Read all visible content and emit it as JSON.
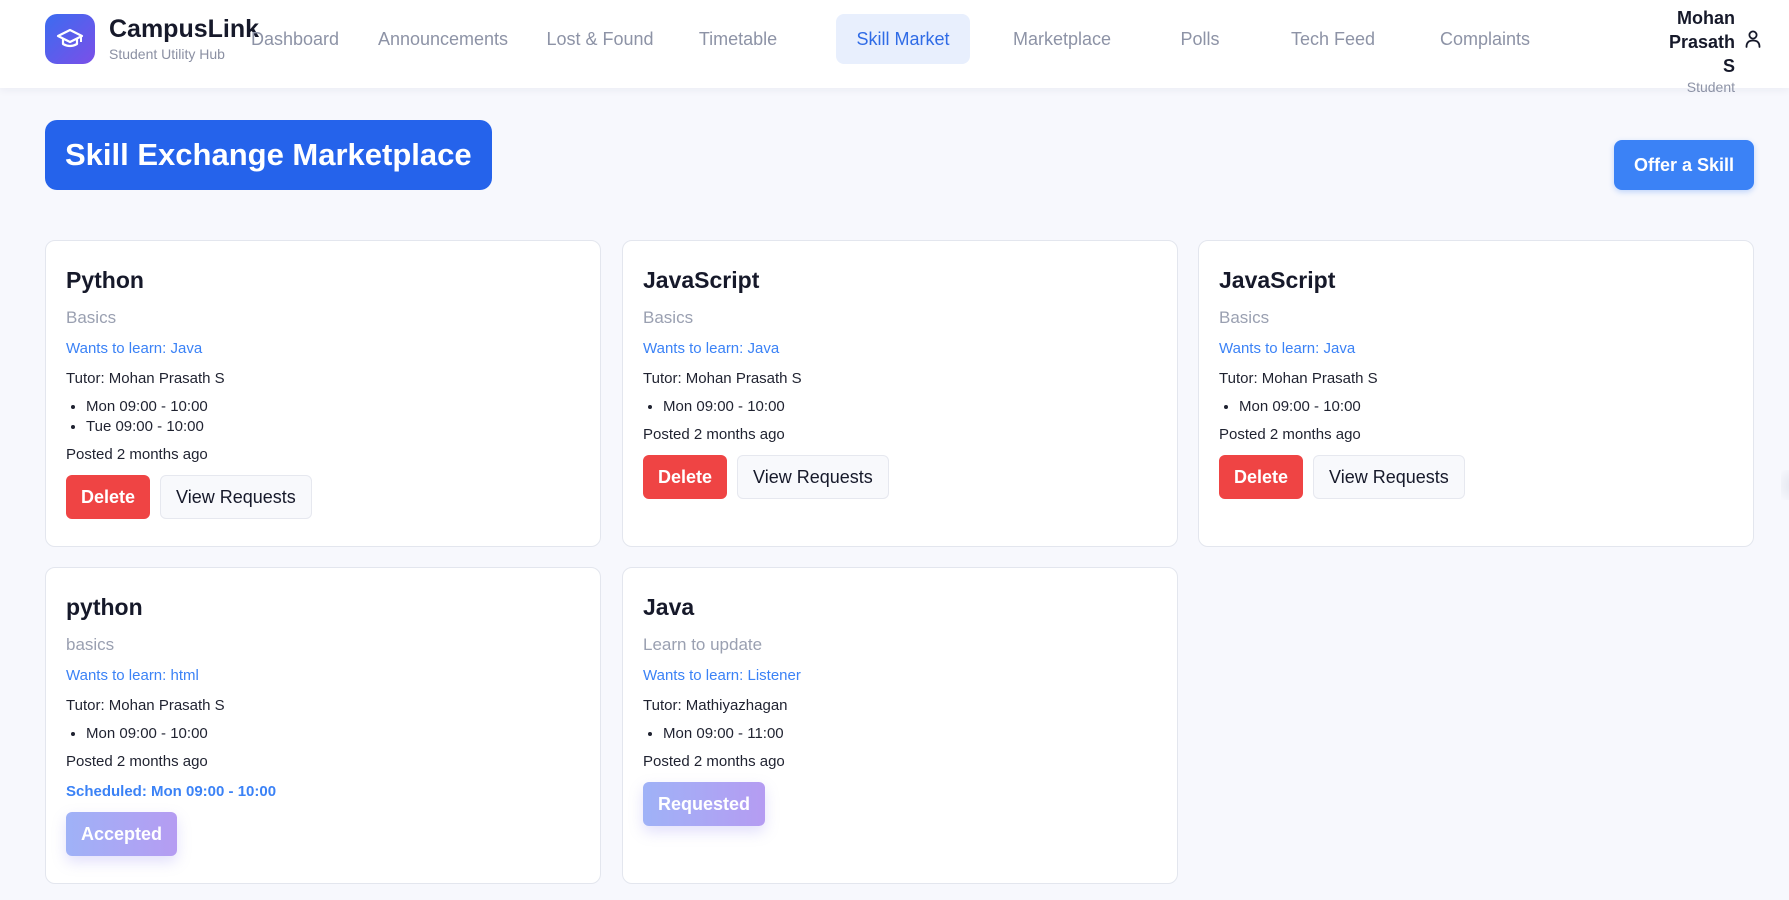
{
  "brand": {
    "name": "CampusLink",
    "subtitle": "Student Utility Hub",
    "logo_icon": "graduation-cap-icon"
  },
  "nav": {
    "items": [
      {
        "label": "Dashboard",
        "active": false
      },
      {
        "label": "Announcements",
        "active": false
      },
      {
        "label": "Lost & Found",
        "active": false
      },
      {
        "label": "Timetable",
        "active": false
      },
      {
        "label": "Skill Market",
        "active": true
      },
      {
        "label": "Marketplace",
        "active": false
      },
      {
        "label": "Polls",
        "active": false
      },
      {
        "label": "Tech Feed",
        "active": false
      },
      {
        "label": "Complaints",
        "active": false
      }
    ]
  },
  "user": {
    "name": "Mohan Prasath S",
    "role": "Student",
    "icon": "user-icon"
  },
  "page": {
    "title": "Skill Exchange Marketplace",
    "offer_button": "Offer a Skill"
  },
  "cards": [
    {
      "title": "Python",
      "description": "Basics",
      "wants": "Wants to learn: Java",
      "tutor": "Tutor: Mohan Prasath S",
      "slots": [
        "Mon 09:00 - 10:00",
        "Tue 09:00 - 10:00"
      ],
      "posted": "Posted 2 months ago",
      "delete_label": "Delete",
      "view_label": "View Requests"
    },
    {
      "title": "JavaScript",
      "description": "Basics",
      "wants": "Wants to learn: Java",
      "tutor": "Tutor: Mohan Prasath S",
      "slots": [
        "Mon 09:00 - 10:00"
      ],
      "posted": "Posted 2 months ago",
      "delete_label": "Delete",
      "view_label": "View Requests"
    },
    {
      "title": "JavaScript",
      "description": "Basics",
      "wants": "Wants to learn: Java",
      "tutor": "Tutor: Mohan Prasath S",
      "slots": [
        "Mon 09:00 - 10:00"
      ],
      "posted": "Posted 2 months ago",
      "delete_label": "Delete",
      "view_label": "View Requests"
    },
    {
      "title": "python",
      "description": "basics",
      "wants": "Wants to learn: html",
      "tutor": "Tutor: Mohan Prasath S",
      "slots": [
        "Mon 09:00 - 10:00"
      ],
      "posted": "Posted 2 months ago",
      "scheduled": "Scheduled: Mon 09:00 - 10:00",
      "status_label": "Accepted"
    },
    {
      "title": "Java",
      "description": "Learn to update",
      "wants": "Wants to learn: Listener",
      "tutor": "Tutor: Mathiyazhagan",
      "slots": [
        "Mon 09:00 - 11:00"
      ],
      "posted": "Posted 2 months ago",
      "status_label": "Requested"
    }
  ],
  "colors": {
    "primary": "#2563eb",
    "accent_blue": "#3b82f6",
    "danger": "#ef4444",
    "nav_active_bg": "#e8effd",
    "background": "#f7f8fd"
  }
}
